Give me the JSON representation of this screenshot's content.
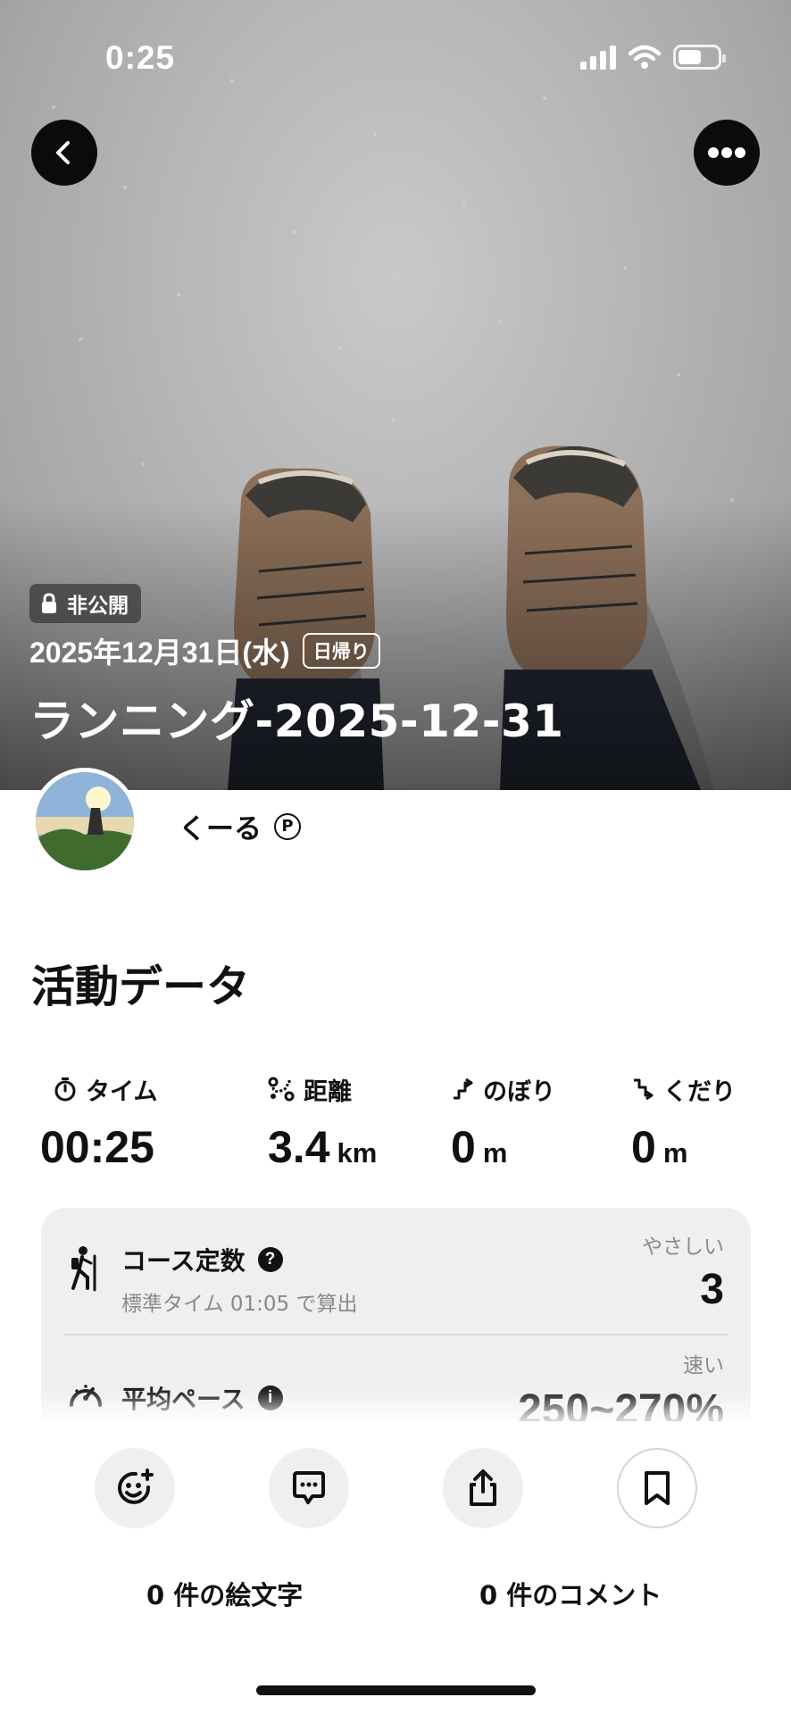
{
  "status_bar": {
    "time": "0:25"
  },
  "header": {
    "back_icon": "chevron-left-icon",
    "more_icon": "ellipsis-icon"
  },
  "activity": {
    "visibility": "非公開",
    "date": "2025年12月31日(水)",
    "trip_type": "日帰り",
    "title": "ランニング-2025-12-31"
  },
  "user": {
    "name": "くーる",
    "badge": "P"
  },
  "section_title": "活動データ",
  "stats": [
    {
      "icon": "stopwatch-icon",
      "label": "タイム",
      "value": "00:25",
      "unit": ""
    },
    {
      "icon": "route-icon",
      "label": "距離",
      "value": "3.4",
      "unit": "km"
    },
    {
      "icon": "ascent-icon",
      "label": "のぼり",
      "value": "0",
      "unit": "m"
    },
    {
      "icon": "descent-icon",
      "label": "くだり",
      "value": "0",
      "unit": "m"
    }
  ],
  "course_constant": {
    "title": "コース定数",
    "subtitle": "標準タイム 01:05 で算出",
    "level": "やさしい",
    "value": "3"
  },
  "average_pace": {
    "title": "平均ペース",
    "level": "速い",
    "value": "250~270%"
  },
  "bottom": {
    "emoji_count_label": "0 件の絵文字",
    "comment_count_label": "0 件のコメント"
  }
}
